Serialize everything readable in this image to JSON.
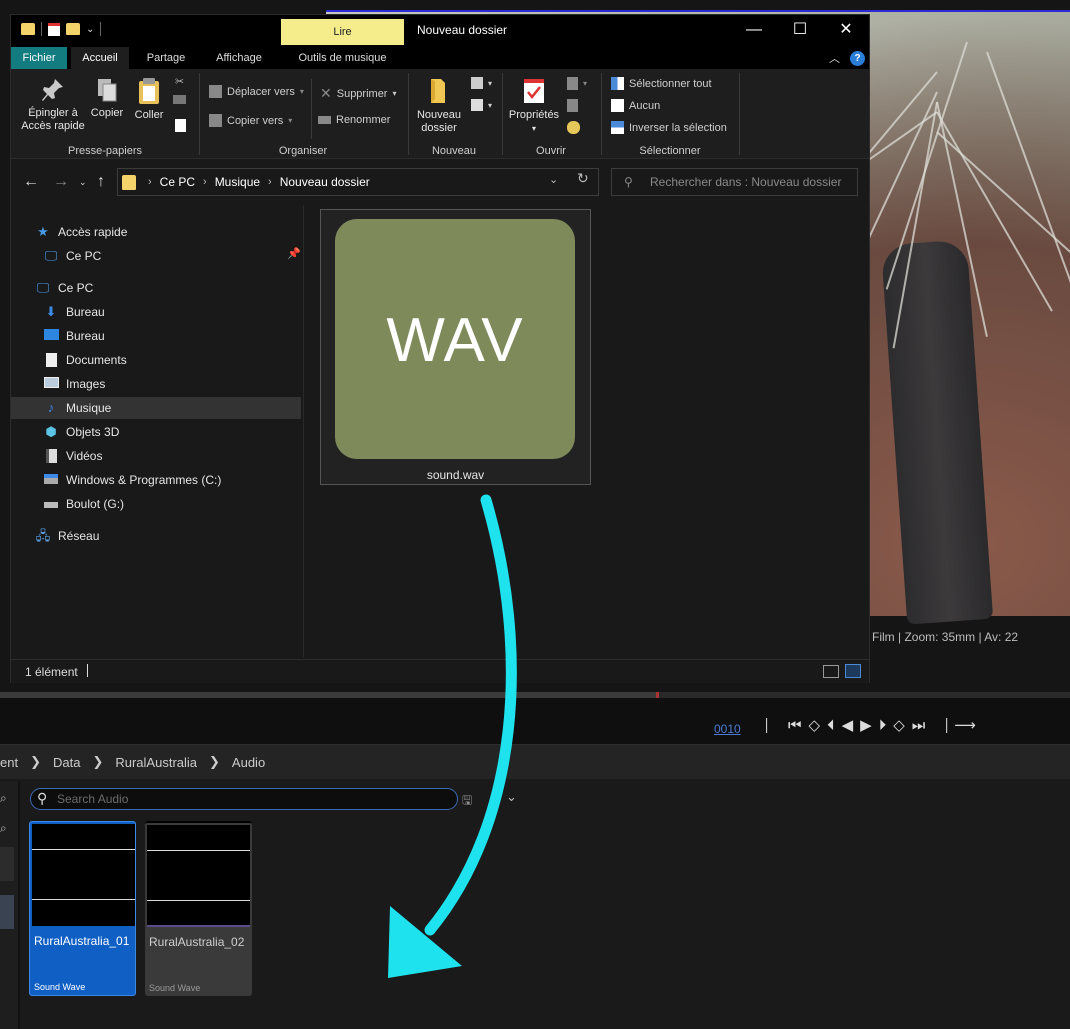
{
  "explorer": {
    "contextual_tab": "Lire",
    "window_title": "Nouveau dossier",
    "tabs": [
      "Fichier",
      "Accueil",
      "Partage",
      "Affichage",
      "Outils de musique"
    ],
    "ribbon": {
      "pin_label_1": "Épingler à",
      "pin_label_2": "Accès rapide",
      "copy": "Copier",
      "paste": "Coller",
      "group_clipboard": "Presse-papiers",
      "move_to": "Déplacer vers",
      "copy_to": "Copier vers",
      "delete": "Supprimer",
      "rename": "Renommer",
      "group_organize": "Organiser",
      "new_folder_1": "Nouveau",
      "new_folder_2": "dossier",
      "group_new": "Nouveau",
      "properties": "Propriétés",
      "group_open": "Ouvrir",
      "select_all": "Sélectionner tout",
      "select_none": "Aucun",
      "invert_selection": "Inverser la sélection",
      "group_select": "Sélectionner"
    },
    "address": [
      "Ce PC",
      "Musique",
      "Nouveau dossier"
    ],
    "search_placeholder": "Rechercher dans : Nouveau dossier",
    "nav": {
      "quick_access": "Accès rapide",
      "this_pc_pinned": "Ce PC",
      "this_pc": "Ce PC",
      "downloads": "Bureau",
      "desktop": "Bureau",
      "documents": "Documents",
      "images": "Images",
      "music": "Musique",
      "objects3d": "Objets 3D",
      "videos": "Vidéos",
      "drive_c": "Windows & Programmes (C:)",
      "drive_g": "Boulot (G:)",
      "network": "Réseau"
    },
    "file": {
      "thumb_text": "WAV",
      "name": "sound.wav"
    },
    "status": "1 élément"
  },
  "editor": {
    "viewport_info": "Film | Zoom: 35mm | Av: 22",
    "frame_counter": "0010",
    "breadcrumb": [
      "ent",
      "Data",
      "RuralAustralia",
      "Audio"
    ],
    "search_placeholder": "Search Audio",
    "assets": [
      {
        "name": "RuralAustralia_01",
        "type": "Sound Wave"
      },
      {
        "name": "RuralAustralia_02",
        "type": "Sound Wave"
      }
    ]
  },
  "colors": {
    "accent_teal": "#127c80",
    "contextual_yellow": "#f5ec8c",
    "wav_thumb": "#7f8a5b",
    "arrow_cyan": "#1ee3ee",
    "selected_asset_blue": "#0f5fc5"
  }
}
